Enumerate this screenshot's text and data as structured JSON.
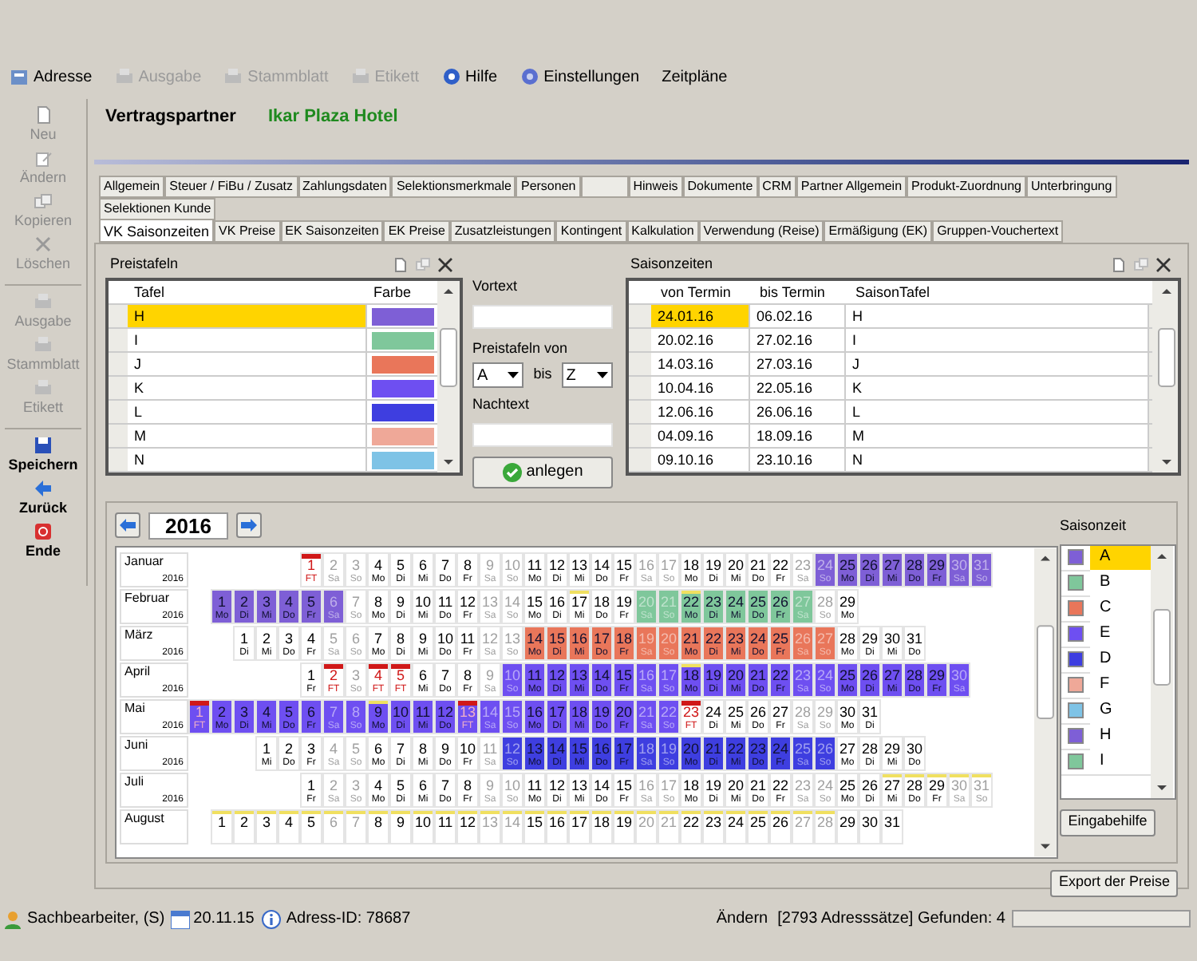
{
  "toolbar": [
    {
      "label": "Adresse",
      "disabled": false
    },
    {
      "label": "Ausgabe",
      "disabled": true
    },
    {
      "label": "Stammblatt",
      "disabled": true
    },
    {
      "label": "Etikett",
      "disabled": true
    },
    {
      "label": "Hilfe",
      "disabled": false
    },
    {
      "label": "Einstellungen",
      "disabled": false
    },
    {
      "label": "Zeitpläne",
      "disabled": false
    }
  ],
  "sidebar": [
    [
      {
        "label": "Neu",
        "disabled": true
      },
      {
        "label": "Ändern",
        "disabled": true
      },
      {
        "label": "Kopieren",
        "disabled": true
      },
      {
        "label": "Löschen",
        "disabled": true
      }
    ],
    [
      {
        "label": "Ausgabe",
        "disabled": true
      },
      {
        "label": "Stammblatt",
        "disabled": true
      },
      {
        "label": "Etikett",
        "disabled": true
      }
    ],
    [
      {
        "label": "Speichern",
        "disabled": false
      },
      {
        "label": "Zurück",
        "disabled": false
      },
      {
        "label": "Ende",
        "disabled": false
      }
    ]
  ],
  "header": {
    "label": "Vertragspartner",
    "value": "Ikar Plaza Hotel"
  },
  "tab_rows": [
    [
      {
        "label": "Allgemein",
        "selected": false
      },
      {
        "label": "Steuer / FiBu / Zusatz",
        "selected": false
      },
      {
        "label": "Zahlungsdaten",
        "selected": false
      },
      {
        "label": "Selektionsmerkmale",
        "selected": false
      },
      {
        "label": "Personen",
        "selected": false
      },
      {
        "label": "Hinweis",
        "selected": false
      },
      {
        "label": "Dokumente",
        "selected": false
      },
      {
        "label": "CRM",
        "selected": false
      },
      {
        "label": "Partner Allgemein",
        "selected": false
      },
      {
        "label": "Produkt-Zuordnung",
        "selected": false
      },
      {
        "label": "Unterbringung",
        "selected": false
      }
    ],
    [
      {
        "label": "Selektionen Kunde",
        "selected": false
      }
    ],
    [
      {
        "label": "VK Saisonzeiten",
        "selected": true
      },
      {
        "label": "VK Preise",
        "selected": false
      },
      {
        "label": "EK Saisonzeiten",
        "selected": false
      },
      {
        "label": "EK Preise",
        "selected": false
      },
      {
        "label": "Zusatzleistungen",
        "selected": false
      },
      {
        "label": "Kontingent",
        "selected": false
      },
      {
        "label": "Kalkulation",
        "selected": false
      },
      {
        "label": "Verwendung (Reise)",
        "selected": false
      },
      {
        "label": "Ermäßigung (EK)",
        "selected": false
      },
      {
        "label": "Gruppen-Vouchertext",
        "selected": false
      }
    ]
  ],
  "preistafeln": {
    "title": "Preistafeln",
    "columns": [
      "Tafel",
      "Farbe"
    ],
    "rows": [
      {
        "tafel": "H",
        "color": "#7e5fd6",
        "selected": true
      },
      {
        "tafel": "I",
        "color": "#7fc79b",
        "selected": false
      },
      {
        "tafel": "J",
        "color": "#e9765a",
        "selected": false
      },
      {
        "tafel": "K",
        "color": "#6e4ff1",
        "selected": false
      },
      {
        "tafel": "L",
        "color": "#3e3ee0",
        "selected": false
      },
      {
        "tafel": "M",
        "color": "#efa898",
        "selected": false
      },
      {
        "tafel": "N",
        "color": "#7ec3e6",
        "selected": false
      }
    ]
  },
  "form": {
    "vortext_label": "Vortext",
    "von_label": "Preistafeln von",
    "von": "A",
    "bis_label": "bis",
    "bis": "Z",
    "nachtext_label": "Nachtext",
    "button": "anlegen"
  },
  "saisonzeiten": {
    "title": "Saisonzeiten",
    "columns": [
      "von Termin",
      "bis Termin",
      "SaisonTafel"
    ],
    "rows": [
      {
        "von": "24.01.16",
        "bis": "06.02.16",
        "tafel": "H",
        "selected": true
      },
      {
        "von": "20.02.16",
        "bis": "27.02.16",
        "tafel": "I",
        "selected": false
      },
      {
        "von": "14.03.16",
        "bis": "27.03.16",
        "tafel": "J",
        "selected": false
      },
      {
        "von": "10.04.16",
        "bis": "22.05.16",
        "tafel": "K",
        "selected": false
      },
      {
        "von": "12.06.16",
        "bis": "26.06.16",
        "tafel": "L",
        "selected": false
      },
      {
        "von": "04.09.16",
        "bis": "18.09.16",
        "tafel": "M",
        "selected": false
      },
      {
        "von": "09.10.16",
        "bis": "23.10.16",
        "tafel": "N",
        "selected": false
      }
    ]
  },
  "year": "2016",
  "months": [
    {
      "name": "Januar",
      "year": "2016",
      "days": [
        {
          "day": "1",
          "wd": "FT",
          "kind": "holiday"
        },
        {
          "day": "2",
          "wd": "Sa",
          "kind": "weekend"
        },
        {
          "day": "3",
          "wd": "So",
          "kind": "weekend"
        },
        {
          "day": "4",
          "wd": "Mo",
          "kind": "work"
        },
        {
          "day": "5",
          "wd": "Di",
          "kind": "work"
        },
        {
          "day": "6",
          "wd": "Mi",
          "kind": "work"
        },
        {
          "day": "7",
          "wd": "Do",
          "kind": "work"
        },
        {
          "day": "8",
          "wd": "Fr",
          "kind": "work"
        },
        {
          "day": "9",
          "wd": "Sa",
          "kind": "weekend"
        },
        {
          "day": "10",
          "wd": "So",
          "kind": "weekend"
        },
        {
          "day": "11",
          "wd": "Mo",
          "kind": "work"
        },
        {
          "day": "12",
          "wd": "Di",
          "kind": "work"
        },
        {
          "day": "13",
          "wd": "Mi",
          "kind": "work"
        },
        {
          "day": "14",
          "wd": "Do",
          "kind": "work"
        },
        {
          "day": "15",
          "wd": "Fr",
          "kind": "work"
        },
        {
          "day": "16",
          "wd": "Sa",
          "kind": "weekend"
        },
        {
          "day": "17",
          "wd": "So",
          "kind": "weekend"
        },
        {
          "day": "18",
          "wd": "Mo",
          "kind": "work"
        },
        {
          "day": "19",
          "wd": "Di",
          "kind": "work"
        },
        {
          "day": "20",
          "wd": "Mi",
          "kind": "work"
        },
        {
          "day": "21",
          "wd": "Do",
          "kind": "work"
        },
        {
          "day": "22",
          "wd": "Fr",
          "kind": "work"
        },
        {
          "day": "23",
          "wd": "Sa",
          "kind": "weekend"
        },
        {
          "day": "24",
          "wd": "So",
          "kind": "weekend",
          "color": "#7e5fd6"
        },
        {
          "day": "25",
          "wd": "Mo",
          "kind": "work",
          "color": "#7e5fd6"
        },
        {
          "day": "26",
          "wd": "Di",
          "kind": "work",
          "color": "#7e5fd6"
        },
        {
          "day": "27",
          "wd": "Mi",
          "kind": "work",
          "color": "#7e5fd6"
        },
        {
          "day": "28",
          "wd": "Do",
          "kind": "work",
          "color": "#7e5fd6"
        },
        {
          "day": "29",
          "wd": "Fr",
          "kind": "work",
          "color": "#7e5fd6"
        },
        {
          "day": "30",
          "wd": "Sa",
          "kind": "weekend",
          "color": "#7e5fd6"
        },
        {
          "day": "31",
          "wd": "So",
          "kind": "weekend",
          "color": "#7e5fd6"
        }
      ]
    },
    {
      "name": "Februar",
      "year": "2016",
      "days": [
        {
          "day": "1",
          "wd": "Mo",
          "kind": "work",
          "color": "#7e5fd6"
        },
        {
          "day": "2",
          "wd": "Di",
          "kind": "work",
          "color": "#7e5fd6"
        },
        {
          "day": "3",
          "wd": "Mi",
          "kind": "work",
          "color": "#7e5fd6"
        },
        {
          "day": "4",
          "wd": "Do",
          "kind": "work",
          "color": "#7e5fd6"
        },
        {
          "day": "5",
          "wd": "Fr",
          "kind": "work",
          "color": "#7e5fd6"
        },
        {
          "day": "6",
          "wd": "Sa",
          "kind": "weekend",
          "color": "#7e5fd6"
        },
        {
          "day": "7",
          "wd": "So",
          "kind": "weekend"
        },
        {
          "day": "8",
          "wd": "Mo",
          "kind": "work"
        },
        {
          "day": "9",
          "wd": "Di",
          "kind": "work"
        },
        {
          "day": "10",
          "wd": "Mi",
          "kind": "work"
        },
        {
          "day": "11",
          "wd": "Do",
          "kind": "work"
        },
        {
          "day": "12",
          "wd": "Fr",
          "kind": "work"
        },
        {
          "day": "13",
          "wd": "Sa",
          "kind": "weekend"
        },
        {
          "day": "14",
          "wd": "So",
          "kind": "weekend"
        },
        {
          "day": "15",
          "wd": "Mo",
          "kind": "work"
        },
        {
          "day": "16",
          "wd": "Di",
          "kind": "work"
        },
        {
          "day": "17",
          "wd": "Mi",
          "kind": "work",
          "flag": true
        },
        {
          "day": "18",
          "wd": "Do",
          "kind": "work"
        },
        {
          "day": "19",
          "wd": "Fr",
          "kind": "work"
        },
        {
          "day": "20",
          "wd": "Sa",
          "kind": "weekend",
          "color": "#7fc79b"
        },
        {
          "day": "21",
          "wd": "So",
          "kind": "weekend",
          "color": "#7fc79b"
        },
        {
          "day": "22",
          "wd": "Mo",
          "kind": "work",
          "color": "#7fc79b",
          "flag": true
        },
        {
          "day": "23",
          "wd": "Di",
          "kind": "work",
          "color": "#7fc79b"
        },
        {
          "day": "24",
          "wd": "Mi",
          "kind": "work",
          "color": "#7fc79b"
        },
        {
          "day": "25",
          "wd": "Do",
          "kind": "work",
          "color": "#7fc79b"
        },
        {
          "day": "26",
          "wd": "Fr",
          "kind": "work",
          "color": "#7fc79b"
        },
        {
          "day": "27",
          "wd": "Sa",
          "kind": "weekend",
          "color": "#7fc79b"
        },
        {
          "day": "28",
          "wd": "So",
          "kind": "weekend"
        },
        {
          "day": "29",
          "wd": "Mo",
          "kind": "work"
        }
      ]
    },
    {
      "name": "März",
      "year": "2016",
      "days": [
        {
          "day": "1",
          "wd": "Di",
          "kind": "work"
        },
        {
          "day": "2",
          "wd": "Mi",
          "kind": "work"
        },
        {
          "day": "3",
          "wd": "Do",
          "kind": "work"
        },
        {
          "day": "4",
          "wd": "Fr",
          "kind": "work"
        },
        {
          "day": "5",
          "wd": "Sa",
          "kind": "weekend"
        },
        {
          "day": "6",
          "wd": "So",
          "kind": "weekend"
        },
        {
          "day": "7",
          "wd": "Mo",
          "kind": "work"
        },
        {
          "day": "8",
          "wd": "Di",
          "kind": "work"
        },
        {
          "day": "9",
          "wd": "Mi",
          "kind": "work"
        },
        {
          "day": "10",
          "wd": "Do",
          "kind": "work"
        },
        {
          "day": "11",
          "wd": "Fr",
          "kind": "work"
        },
        {
          "day": "12",
          "wd": "Sa",
          "kind": "weekend"
        },
        {
          "day": "13",
          "wd": "So",
          "kind": "weekend"
        },
        {
          "day": "14",
          "wd": "Mo",
          "kind": "work",
          "color": "#e9765a"
        },
        {
          "day": "15",
          "wd": "Di",
          "kind": "work",
          "color": "#e9765a"
        },
        {
          "day": "16",
          "wd": "Mi",
          "kind": "work",
          "color": "#e9765a"
        },
        {
          "day": "17",
          "wd": "Do",
          "kind": "work",
          "color": "#e9765a"
        },
        {
          "day": "18",
          "wd": "Fr",
          "kind": "work",
          "color": "#e9765a"
        },
        {
          "day": "19",
          "wd": "Sa",
          "kind": "weekend",
          "color": "#e9765a"
        },
        {
          "day": "20",
          "wd": "So",
          "kind": "weekend",
          "color": "#e9765a"
        },
        {
          "day": "21",
          "wd": "Mo",
          "kind": "work",
          "color": "#e9765a"
        },
        {
          "day": "22",
          "wd": "Di",
          "kind": "work",
          "color": "#e9765a"
        },
        {
          "day": "23",
          "wd": "Mi",
          "kind": "work",
          "color": "#e9765a"
        },
        {
          "day": "24",
          "wd": "Do",
          "kind": "work",
          "color": "#e9765a"
        },
        {
          "day": "25",
          "wd": "Fr",
          "kind": "work",
          "color": "#e9765a"
        },
        {
          "day": "26",
          "wd": "Sa",
          "kind": "weekend",
          "color": "#e9765a"
        },
        {
          "day": "27",
          "wd": "So",
          "kind": "weekend",
          "color": "#e9765a"
        },
        {
          "day": "28",
          "wd": "Mo",
          "kind": "work"
        },
        {
          "day": "29",
          "wd": "Di",
          "kind": "work"
        },
        {
          "day": "30",
          "wd": "Mi",
          "kind": "work"
        },
        {
          "day": "31",
          "wd": "Do",
          "kind": "work"
        }
      ]
    },
    {
      "name": "April",
      "year": "2016",
      "days": [
        {
          "day": "1",
          "wd": "Fr",
          "kind": "work"
        },
        {
          "day": "2",
          "wd": "FT",
          "kind": "holiday"
        },
        {
          "day": "3",
          "wd": "So",
          "kind": "weekend"
        },
        {
          "day": "4",
          "wd": "FT",
          "kind": "holiday"
        },
        {
          "day": "5",
          "wd": "FT",
          "kind": "holiday"
        },
        {
          "day": "6",
          "wd": "Mi",
          "kind": "work"
        },
        {
          "day": "7",
          "wd": "Do",
          "kind": "work"
        },
        {
          "day": "8",
          "wd": "Fr",
          "kind": "work"
        },
        {
          "day": "9",
          "wd": "Sa",
          "kind": "weekend"
        },
        {
          "day": "10",
          "wd": "So",
          "kind": "weekend",
          "color": "#6e4ff1"
        },
        {
          "day": "11",
          "wd": "Mo",
          "kind": "work",
          "color": "#6e4ff1"
        },
        {
          "day": "12",
          "wd": "Di",
          "kind": "work",
          "color": "#6e4ff1"
        },
        {
          "day": "13",
          "wd": "Mi",
          "kind": "work",
          "color": "#6e4ff1"
        },
        {
          "day": "14",
          "wd": "Do",
          "kind": "work",
          "color": "#6e4ff1"
        },
        {
          "day": "15",
          "wd": "Fr",
          "kind": "work",
          "color": "#6e4ff1"
        },
        {
          "day": "16",
          "wd": "Sa",
          "kind": "weekend",
          "color": "#6e4ff1"
        },
        {
          "day": "17",
          "wd": "So",
          "kind": "weekend",
          "color": "#6e4ff1"
        },
        {
          "day": "18",
          "wd": "Mo",
          "kind": "work",
          "color": "#6e4ff1",
          "flag": true
        },
        {
          "day": "19",
          "wd": "Di",
          "kind": "work",
          "color": "#6e4ff1"
        },
        {
          "day": "20",
          "wd": "Mi",
          "kind": "work",
          "color": "#6e4ff1"
        },
        {
          "day": "21",
          "wd": "Do",
          "kind": "work",
          "color": "#6e4ff1"
        },
        {
          "day": "22",
          "wd": "Fr",
          "kind": "work",
          "color": "#6e4ff1"
        },
        {
          "day": "23",
          "wd": "Sa",
          "kind": "weekend",
          "color": "#6e4ff1"
        },
        {
          "day": "24",
          "wd": "So",
          "kind": "weekend",
          "color": "#6e4ff1"
        },
        {
          "day": "25",
          "wd": "Mo",
          "kind": "work",
          "color": "#6e4ff1"
        },
        {
          "day": "26",
          "wd": "Di",
          "kind": "work",
          "color": "#6e4ff1"
        },
        {
          "day": "27",
          "wd": "Mi",
          "kind": "work",
          "color": "#6e4ff1"
        },
        {
          "day": "28",
          "wd": "Do",
          "kind": "work",
          "color": "#6e4ff1"
        },
        {
          "day": "29",
          "wd": "Fr",
          "kind": "work",
          "color": "#6e4ff1"
        },
        {
          "day": "30",
          "wd": "Sa",
          "kind": "weekend",
          "color": "#6e4ff1"
        }
      ]
    },
    {
      "name": "Mai",
      "year": "2016",
      "days": [
        {
          "day": "1",
          "wd": "FT",
          "kind": "holiday",
          "color": "#6e4ff1"
        },
        {
          "day": "2",
          "wd": "Mo",
          "kind": "work",
          "color": "#6e4ff1"
        },
        {
          "day": "3",
          "wd": "Di",
          "kind": "work",
          "color": "#6e4ff1"
        },
        {
          "day": "4",
          "wd": "Mi",
          "kind": "work",
          "color": "#6e4ff1"
        },
        {
          "day": "5",
          "wd": "Do",
          "kind": "work",
          "color": "#6e4ff1"
        },
        {
          "day": "6",
          "wd": "Fr",
          "kind": "work",
          "color": "#6e4ff1"
        },
        {
          "day": "7",
          "wd": "Sa",
          "kind": "weekend",
          "color": "#6e4ff1"
        },
        {
          "day": "8",
          "wd": "So",
          "kind": "weekend",
          "color": "#6e4ff1"
        },
        {
          "day": "9",
          "wd": "Mo",
          "kind": "work",
          "color": "#6e4ff1",
          "flag": true
        },
        {
          "day": "10",
          "wd": "Di",
          "kind": "work",
          "color": "#6e4ff1"
        },
        {
          "day": "11",
          "wd": "Mi",
          "kind": "work",
          "color": "#6e4ff1"
        },
        {
          "day": "12",
          "wd": "Do",
          "kind": "work",
          "color": "#6e4ff1"
        },
        {
          "day": "13",
          "wd": "FT",
          "kind": "holiday",
          "color": "#6e4ff1"
        },
        {
          "day": "14",
          "wd": "Sa",
          "kind": "weekend",
          "color": "#6e4ff1"
        },
        {
          "day": "15",
          "wd": "So",
          "kind": "weekend",
          "color": "#6e4ff1"
        },
        {
          "day": "16",
          "wd": "Mo",
          "kind": "work",
          "color": "#6e4ff1"
        },
        {
          "day": "17",
          "wd": "Di",
          "kind": "work",
          "color": "#6e4ff1"
        },
        {
          "day": "18",
          "wd": "Mi",
          "kind": "work",
          "color": "#6e4ff1"
        },
        {
          "day": "19",
          "wd": "Do",
          "kind": "work",
          "color": "#6e4ff1"
        },
        {
          "day": "20",
          "wd": "Fr",
          "kind": "work",
          "color": "#6e4ff1"
        },
        {
          "day": "21",
          "wd": "Sa",
          "kind": "weekend",
          "color": "#6e4ff1"
        },
        {
          "day": "22",
          "wd": "So",
          "kind": "weekend",
          "color": "#6e4ff1"
        },
        {
          "day": "23",
          "wd": "FT",
          "kind": "holiday"
        },
        {
          "day": "24",
          "wd": "Di",
          "kind": "work"
        },
        {
          "day": "25",
          "wd": "Mi",
          "kind": "work"
        },
        {
          "day": "26",
          "wd": "Do",
          "kind": "work"
        },
        {
          "day": "27",
          "wd": "Fr",
          "kind": "work"
        },
        {
          "day": "28",
          "wd": "Sa",
          "kind": "weekend"
        },
        {
          "day": "29",
          "wd": "So",
          "kind": "weekend"
        },
        {
          "day": "30",
          "wd": "Mo",
          "kind": "work"
        },
        {
          "day": "31",
          "wd": "Di",
          "kind": "work"
        }
      ]
    },
    {
      "name": "Juni",
      "year": "2016",
      "days": [
        {
          "day": "1",
          "wd": "Mi",
          "kind": "work"
        },
        {
          "day": "2",
          "wd": "Do",
          "kind": "work"
        },
        {
          "day": "3",
          "wd": "Fr",
          "kind": "work"
        },
        {
          "day": "4",
          "wd": "Sa",
          "kind": "weekend"
        },
        {
          "day": "5",
          "wd": "So",
          "kind": "weekend"
        },
        {
          "day": "6",
          "wd": "Mo",
          "kind": "work"
        },
        {
          "day": "7",
          "wd": "Di",
          "kind": "work"
        },
        {
          "day": "8",
          "wd": "Mi",
          "kind": "work"
        },
        {
          "day": "9",
          "wd": "Do",
          "kind": "work"
        },
        {
          "day": "10",
          "wd": "Fr",
          "kind": "work"
        },
        {
          "day": "11",
          "wd": "Sa",
          "kind": "weekend"
        },
        {
          "day": "12",
          "wd": "So",
          "kind": "weekend",
          "color": "#3e3ee0"
        },
        {
          "day": "13",
          "wd": "Mo",
          "kind": "work",
          "color": "#3e3ee0"
        },
        {
          "day": "14",
          "wd": "Di",
          "kind": "work",
          "color": "#3e3ee0"
        },
        {
          "day": "15",
          "wd": "Mi",
          "kind": "work",
          "color": "#3e3ee0"
        },
        {
          "day": "16",
          "wd": "Do",
          "kind": "work",
          "color": "#3e3ee0"
        },
        {
          "day": "17",
          "wd": "Fr",
          "kind": "work",
          "color": "#3e3ee0"
        },
        {
          "day": "18",
          "wd": "Sa",
          "kind": "weekend",
          "color": "#3e3ee0"
        },
        {
          "day": "19",
          "wd": "So",
          "kind": "weekend",
          "color": "#3e3ee0"
        },
        {
          "day": "20",
          "wd": "Mo",
          "kind": "work",
          "color": "#3e3ee0"
        },
        {
          "day": "21",
          "wd": "Di",
          "kind": "work",
          "color": "#3e3ee0"
        },
        {
          "day": "22",
          "wd": "Mi",
          "kind": "work",
          "color": "#3e3ee0"
        },
        {
          "day": "23",
          "wd": "Do",
          "kind": "work",
          "color": "#3e3ee0"
        },
        {
          "day": "24",
          "wd": "Fr",
          "kind": "work",
          "color": "#3e3ee0"
        },
        {
          "day": "25",
          "wd": "Sa",
          "kind": "weekend",
          "color": "#3e3ee0"
        },
        {
          "day": "26",
          "wd": "So",
          "kind": "weekend",
          "color": "#3e3ee0"
        },
        {
          "day": "27",
          "wd": "Mo",
          "kind": "work"
        },
        {
          "day": "28",
          "wd": "Di",
          "kind": "work"
        },
        {
          "day": "29",
          "wd": "Mi",
          "kind": "work"
        },
        {
          "day": "30",
          "wd": "Do",
          "kind": "work"
        }
      ]
    },
    {
      "name": "Juli",
      "year": "2016",
      "days": [
        {
          "day": "1",
          "wd": "Fr",
          "kind": "work"
        },
        {
          "day": "2",
          "wd": "Sa",
          "kind": "weekend"
        },
        {
          "day": "3",
          "wd": "So",
          "kind": "weekend"
        },
        {
          "day": "4",
          "wd": "Mo",
          "kind": "work"
        },
        {
          "day": "5",
          "wd": "Di",
          "kind": "work"
        },
        {
          "day": "6",
          "wd": "Mi",
          "kind": "work"
        },
        {
          "day": "7",
          "wd": "Do",
          "kind": "work"
        },
        {
          "day": "8",
          "wd": "Fr",
          "kind": "work"
        },
        {
          "day": "9",
          "wd": "Sa",
          "kind": "weekend"
        },
        {
          "day": "10",
          "wd": "So",
          "kind": "weekend"
        },
        {
          "day": "11",
          "wd": "Mo",
          "kind": "work"
        },
        {
          "day": "12",
          "wd": "Di",
          "kind": "work"
        },
        {
          "day": "13",
          "wd": "Mi",
          "kind": "work"
        },
        {
          "day": "14",
          "wd": "Do",
          "kind": "work"
        },
        {
          "day": "15",
          "wd": "Fr",
          "kind": "work"
        },
        {
          "day": "16",
          "wd": "Sa",
          "kind": "weekend"
        },
        {
          "day": "17",
          "wd": "So",
          "kind": "weekend"
        },
        {
          "day": "18",
          "wd": "Mo",
          "kind": "work"
        },
        {
          "day": "19",
          "wd": "Di",
          "kind": "work"
        },
        {
          "day": "20",
          "wd": "Mi",
          "kind": "work"
        },
        {
          "day": "21",
          "wd": "Do",
          "kind": "work"
        },
        {
          "day": "22",
          "wd": "Fr",
          "kind": "work"
        },
        {
          "day": "23",
          "wd": "Sa",
          "kind": "weekend"
        },
        {
          "day": "24",
          "wd": "So",
          "kind": "weekend"
        },
        {
          "day": "25",
          "wd": "Mo",
          "kind": "work"
        },
        {
          "day": "26",
          "wd": "Di",
          "kind": "work"
        },
        {
          "day": "27",
          "wd": "Mi",
          "kind": "work",
          "flag": true
        },
        {
          "day": "28",
          "wd": "Do",
          "kind": "work",
          "flag": true
        },
        {
          "day": "29",
          "wd": "Fr",
          "kind": "work",
          "flag": true
        },
        {
          "day": "30",
          "wd": "Sa",
          "kind": "weekend",
          "flag": true
        },
        {
          "day": "31",
          "wd": "So",
          "kind": "weekend",
          "flag": true
        }
      ]
    },
    {
      "name": "August",
      "days": [
        {
          "day": "1",
          "kind": "work",
          "flag": true
        },
        {
          "day": "2",
          "kind": "work",
          "flag": true
        },
        {
          "day": "3",
          "kind": "work",
          "flag": true
        },
        {
          "day": "4",
          "kind": "work",
          "flag": true
        },
        {
          "day": "5",
          "kind": "work",
          "flag": true
        },
        {
          "day": "6",
          "kind": "weekend",
          "flag": true
        },
        {
          "day": "7",
          "kind": "weekend",
          "flag": true
        },
        {
          "day": "8",
          "kind": "work",
          "flag": true
        },
        {
          "day": "9",
          "kind": "work",
          "flag": true
        },
        {
          "day": "10",
          "kind": "work",
          "flag": true
        },
        {
          "day": "11",
          "kind": "work",
          "flag": true
        },
        {
          "day": "12",
          "kind": "work",
          "flag": true
        },
        {
          "day": "13",
          "kind": "weekend",
          "flag": true
        },
        {
          "day": "14",
          "kind": "weekend",
          "flag": true
        },
        {
          "day": "15",
          "kind": "work",
          "flag": true
        },
        {
          "day": "16",
          "kind": "work",
          "flag": true
        },
        {
          "day": "17",
          "kind": "work",
          "flag": true
        },
        {
          "day": "18",
          "kind": "work",
          "flag": true
        },
        {
          "day": "19",
          "kind": "work",
          "flag": true
        },
        {
          "day": "20",
          "kind": "weekend",
          "flag": true
        },
        {
          "day": "21",
          "kind": "weekend",
          "flag": true
        },
        {
          "day": "22",
          "kind": "work",
          "flag": true
        },
        {
          "day": "23",
          "kind": "work",
          "flag": true
        },
        {
          "day": "24",
          "kind": "work",
          "flag": true
        },
        {
          "day": "25",
          "kind": "work",
          "flag": true
        },
        {
          "day": "26",
          "kind": "work",
          "flag": true
        },
        {
          "day": "27",
          "kind": "weekend",
          "flag": true
        },
        {
          "day": "28",
          "kind": "weekend",
          "flag": true
        },
        {
          "day": "29",
          "kind": "work"
        },
        {
          "day": "30",
          "kind": "work"
        },
        {
          "day": "31",
          "kind": "work"
        }
      ]
    }
  ],
  "saisonzeit": {
    "title": "Saisonzeit",
    "items": [
      {
        "label": "A",
        "color": "#7e5fd6",
        "selected": true
      },
      {
        "label": "B",
        "color": "#7fc79b",
        "selected": false
      },
      {
        "label": "C",
        "color": "#e9765a",
        "selected": false
      },
      {
        "label": "E",
        "color": "#6e4ff1",
        "selected": false
      },
      {
        "label": "D",
        "color": "#3e3ee0",
        "selected": false
      },
      {
        "label": "F",
        "color": "#efa898",
        "selected": false
      },
      {
        "label": "G",
        "color": "#7ec3e6",
        "selected": false
      },
      {
        "label": "H",
        "color": "#7e5fd6",
        "selected": false
      },
      {
        "label": "I",
        "color": "#7fc79b",
        "selected": false
      }
    ],
    "button": "Eingabehilfe"
  },
  "export_button": "Export der Preise",
  "status_bar": {
    "user": "Sachbearbeiter, (S)",
    "date": "20.11.15",
    "address_id": "Adress-ID: 78687",
    "mode": "Ändern",
    "count": "[2793 Adresssätze] Gefunden: 4",
    "level": 0
  }
}
